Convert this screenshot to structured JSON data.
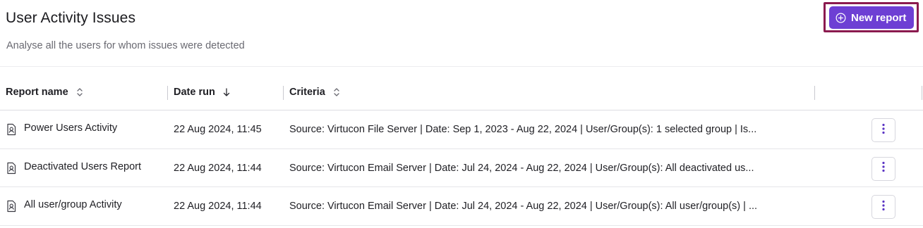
{
  "header": {
    "title": "User Activity Issues",
    "subtitle": "Analyse all the users for whom issues were detected",
    "new_report_label": "New report",
    "accent_color": "#6d3fd4",
    "highlight_color": "#8b1a4f"
  },
  "table": {
    "columns": [
      {
        "label": "Report name",
        "sort_icon": "sort-updown-icon"
      },
      {
        "label": "Date run",
        "sort_icon": "arrow-down-icon"
      },
      {
        "label": "Criteria",
        "sort_icon": "sort-updown-icon"
      }
    ],
    "rows": [
      {
        "name": "Power Users Activity",
        "date_run": "22 Aug 2024, 11:45",
        "criteria": "Source: Virtucon File Server | Date: Sep 1, 2023 - Aug 22, 2024 | User/Group(s): 1 selected group | Is..."
      },
      {
        "name": "Deactivated Users Report",
        "date_run": "22 Aug 2024, 11:44",
        "criteria": "Source: Virtucon Email Server | Date: Jul 24, 2024 - Aug 22, 2024 | User/Group(s): All deactivated us..."
      },
      {
        "name": "All user/group Activity",
        "date_run": "22 Aug 2024, 11:44",
        "criteria": "Source: Virtucon Email Server | Date: Jul 24, 2024 - Aug 22, 2024 | User/Group(s): All user/group(s) | ..."
      }
    ]
  },
  "icons": {
    "row_icon": "report-document-icon",
    "row_action": "kebab-menu-icon",
    "new_report": "plus-circle-icon"
  }
}
